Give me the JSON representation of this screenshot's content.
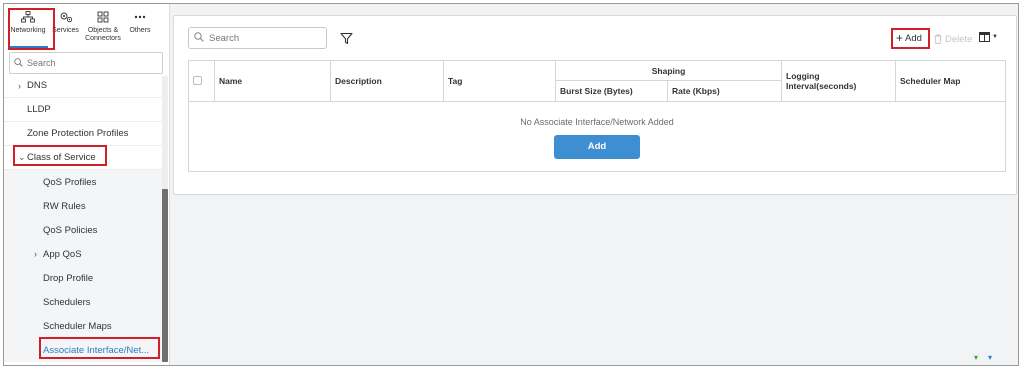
{
  "topnav": {
    "tabs": [
      {
        "label": "Networking",
        "icon": "network-icon"
      },
      {
        "label": "Services",
        "icon": "gears-icon"
      },
      {
        "label": "Objects & Connectors",
        "label_line1": "Objects &",
        "label_line2": "Connectors",
        "icon": "objects-icon"
      },
      {
        "label": "Others",
        "icon": "more-icon"
      }
    ],
    "active": "Networking"
  },
  "sidebar": {
    "search_placeholder": "Search",
    "items": [
      {
        "label": "DNS",
        "level": 0,
        "chevron": "right"
      },
      {
        "label": "LLDP",
        "level": 0
      },
      {
        "label": "Zone Protection Profiles",
        "level": 0
      },
      {
        "label": "Class of Service",
        "level": 0,
        "chevron": "down",
        "expanded": true
      },
      {
        "label": "QoS Profiles",
        "level": 1
      },
      {
        "label": "RW Rules",
        "level": 1
      },
      {
        "label": "QoS Policies",
        "level": 1
      },
      {
        "label": "App QoS",
        "level": 1,
        "chevron": "right"
      },
      {
        "label": "Drop Profile",
        "level": 1
      },
      {
        "label": "Schedulers",
        "level": 1
      },
      {
        "label": "Scheduler Maps",
        "level": 1
      },
      {
        "label": "Associate Interface/Net...",
        "level": 1,
        "active": true
      }
    ]
  },
  "main": {
    "search_placeholder": "Search",
    "toolbar": {
      "add_label": "Add",
      "delete_label": "Delete"
    },
    "table": {
      "columns": {
        "name": "Name",
        "description": "Description",
        "tag": "Tag",
        "shaping": "Shaping",
        "burst_size": "Burst Size (Bytes)",
        "rate": "Rate (Kbps)",
        "logging_interval": "Logging Interval(seconds)",
        "scheduler_map": "Scheduler Map"
      },
      "empty_message": "No Associate Interface/Network Added",
      "empty_add_label": "Add"
    }
  },
  "colors": {
    "accent": "#2a7fc4",
    "button": "#3e8ed2",
    "highlight": "#d0202a"
  }
}
